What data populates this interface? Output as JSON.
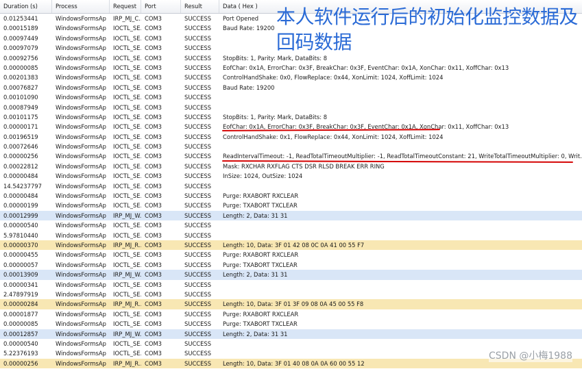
{
  "columns": {
    "duration": "Duration (s)",
    "process": "Process",
    "request": "Request",
    "port": "Port",
    "result": "Result",
    "data": "Data ( Hex )"
  },
  "rows": [
    {
      "duration": "0.01253441",
      "process": "WindowsFormsAp",
      "request": "IRP_MJ_C...",
      "port": "COM3",
      "result": "SUCCESS",
      "data": "Port Opened",
      "highlight": "none"
    },
    {
      "duration": "0.00015189",
      "process": "WindowsFormsAp",
      "request": "IOCTL_SE...",
      "port": "COM3",
      "result": "SUCCESS",
      "data": "Baud Rate: 19200",
      "highlight": "none"
    },
    {
      "duration": "0.00097449",
      "process": "WindowsFormsAp",
      "request": "IOCTL_SE...",
      "port": "COM3",
      "result": "SUCCESS",
      "data": "",
      "highlight": "none"
    },
    {
      "duration": "0.00097079",
      "process": "WindowsFormsAp",
      "request": "IOCTL_SE...",
      "port": "COM3",
      "result": "SUCCESS",
      "data": "",
      "highlight": "none"
    },
    {
      "duration": "0.00092756",
      "process": "WindowsFormsAp",
      "request": "IOCTL_SE...",
      "port": "COM3",
      "result": "SUCCESS",
      "data": "StopBits: 1, Parity: Mark, DataBits: 8",
      "highlight": "none"
    },
    {
      "duration": "0.00000085",
      "process": "WindowsFormsAp",
      "request": "IOCTL_SE...",
      "port": "COM3",
      "result": "SUCCESS",
      "data": "EofChar: 0x1A, ErrorChar: 0x3F, BreakChar: 0x3F, EventChar: 0x1A, XonChar: 0x11, XoffChar: 0x13",
      "highlight": "none"
    },
    {
      "duration": "0.00201383",
      "process": "WindowsFormsAp",
      "request": "IOCTL_SE...",
      "port": "COM3",
      "result": "SUCCESS",
      "data": "ControlHandShake: 0x0, FlowReplace: 0x44, XonLimit: 1024, XoffLimit: 1024",
      "highlight": "none"
    },
    {
      "duration": "0.00076827",
      "process": "WindowsFormsAp",
      "request": "IOCTL_SE...",
      "port": "COM3",
      "result": "SUCCESS",
      "data": "Baud Rate: 19200",
      "highlight": "none"
    },
    {
      "duration": "0.00101090",
      "process": "WindowsFormsAp",
      "request": "IOCTL_SE...",
      "port": "COM3",
      "result": "SUCCESS",
      "data": "",
      "highlight": "none"
    },
    {
      "duration": "0.00087949",
      "process": "WindowsFormsAp",
      "request": "IOCTL_SE...",
      "port": "COM3",
      "result": "SUCCESS",
      "data": "",
      "highlight": "none"
    },
    {
      "duration": "0.00101175",
      "process": "WindowsFormsAp",
      "request": "IOCTL_SE...",
      "port": "COM3",
      "result": "SUCCESS",
      "data": "StopBits: 1, Parity: Mark, DataBits: 8",
      "highlight": "none"
    },
    {
      "duration": "0.00000171",
      "process": "WindowsFormsAp",
      "request": "IOCTL_SE...",
      "port": "COM3",
      "result": "SUCCESS",
      "data": "EofChar: 0x1A, ErrorChar: 0x3F, BreakChar: 0x3F, EventChar: 0x1A, XonChar: 0x11, XoffChar: 0x13",
      "highlight": "none"
    },
    {
      "duration": "0.00196519",
      "process": "WindowsFormsAp",
      "request": "IOCTL_SE...",
      "port": "COM3",
      "result": "SUCCESS",
      "data": "ControlHandShake: 0x1, FlowReplace: 0x44, XonLimit: 1024, XoffLimit: 1024",
      "highlight": "none"
    },
    {
      "duration": "0.00072646",
      "process": "WindowsFormsAp",
      "request": "IOCTL_SE...",
      "port": "COM3",
      "result": "SUCCESS",
      "data": "",
      "highlight": "none"
    },
    {
      "duration": "0.00000256",
      "process": "WindowsFormsAp",
      "request": "IOCTL_SE...",
      "port": "COM3",
      "result": "SUCCESS",
      "data": "ReadIntervalTimeout: -1, ReadTotalTimeoutMultiplier: -1, ReadTotalTimeoutConstant: 21, WriteTotalTimeoutMultiplier: 0, Writ...",
      "highlight": "none"
    },
    {
      "duration": "0.00022812",
      "process": "WindowsFormsAp",
      "request": "IOCTL_SE...",
      "port": "COM3",
      "result": "SUCCESS",
      "data": "Mask: RXCHAR RXFLAG CTS DSR RLSD BREAK ERR RING",
      "highlight": "none"
    },
    {
      "duration": "0.00000484",
      "process": "WindowsFormsAp",
      "request": "IOCTL_SE...",
      "port": "COM3",
      "result": "SUCCESS",
      "data": "InSize: 1024, OutSize: 1024",
      "highlight": "none"
    },
    {
      "duration": "14.54237797",
      "process": "WindowsFormsAp",
      "request": "IOCTL_SE...",
      "port": "COM3",
      "result": "SUCCESS",
      "data": "",
      "highlight": "none"
    },
    {
      "duration": "0.00000484",
      "process": "WindowsFormsAp",
      "request": "IOCTL_SE...",
      "port": "COM3",
      "result": "SUCCESS",
      "data": "Purge: RXABORT RXCLEAR",
      "highlight": "none"
    },
    {
      "duration": "0.00000199",
      "process": "WindowsFormsAp",
      "request": "IOCTL_SE...",
      "port": "COM3",
      "result": "SUCCESS",
      "data": "Purge: TXABORT TXCLEAR",
      "highlight": "none"
    },
    {
      "duration": "0.00012999",
      "process": "WindowsFormsAp",
      "request": "IRP_MJ_W...",
      "port": "COM3",
      "result": "SUCCESS",
      "data": "Length: 2, Data: 31 31",
      "highlight": "blue"
    },
    {
      "duration": "0.00000540",
      "process": "WindowsFormsAp",
      "request": "IOCTL_SE...",
      "port": "COM3",
      "result": "SUCCESS",
      "data": "",
      "highlight": "none"
    },
    {
      "duration": "5.97810440",
      "process": "WindowsFormsAp",
      "request": "IOCTL_SE...",
      "port": "COM3",
      "result": "SUCCESS",
      "data": "",
      "highlight": "none"
    },
    {
      "duration": "0.00000370",
      "process": "WindowsFormsAp",
      "request": "IRP_MJ_R...",
      "port": "COM3",
      "result": "SUCCESS",
      "data": "Length: 10, Data: 3F 01 42 08 0C 0A 41 00 55 F7",
      "highlight": "yellow"
    },
    {
      "duration": "0.00000455",
      "process": "WindowsFormsAp",
      "request": "IOCTL_SE...",
      "port": "COM3",
      "result": "SUCCESS",
      "data": "Purge: RXABORT RXCLEAR",
      "highlight": "none"
    },
    {
      "duration": "0.00000057",
      "process": "WindowsFormsAp",
      "request": "IOCTL_SE...",
      "port": "COM3",
      "result": "SUCCESS",
      "data": "Purge: TXABORT TXCLEAR",
      "highlight": "none"
    },
    {
      "duration": "0.00013909",
      "process": "WindowsFormsAp",
      "request": "IRP_MJ_W...",
      "port": "COM3",
      "result": "SUCCESS",
      "data": "Length: 2, Data: 31 31",
      "highlight": "blue"
    },
    {
      "duration": "0.00000341",
      "process": "WindowsFormsAp",
      "request": "IOCTL_SE...",
      "port": "COM3",
      "result": "SUCCESS",
      "data": "",
      "highlight": "none"
    },
    {
      "duration": "2.47897919",
      "process": "WindowsFormsAp",
      "request": "IOCTL_SE...",
      "port": "COM3",
      "result": "SUCCESS",
      "data": "",
      "highlight": "none"
    },
    {
      "duration": "0.00000284",
      "process": "WindowsFormsAp",
      "request": "IRP_MJ_R...",
      "port": "COM3",
      "result": "SUCCESS",
      "data": "Length: 10, Data: 3F 01 3F 09 08 0A 45 00 55 F8",
      "highlight": "yellow"
    },
    {
      "duration": "0.00001877",
      "process": "WindowsFormsAp",
      "request": "IOCTL_SE...",
      "port": "COM3",
      "result": "SUCCESS",
      "data": "Purge: RXABORT RXCLEAR",
      "highlight": "none"
    },
    {
      "duration": "0.00000085",
      "process": "WindowsFormsAp",
      "request": "IOCTL_SE...",
      "port": "COM3",
      "result": "SUCCESS",
      "data": "Purge: TXABORT TXCLEAR",
      "highlight": "none"
    },
    {
      "duration": "0.00012857",
      "process": "WindowsFormsAp",
      "request": "IRP_MJ_W...",
      "port": "COM3",
      "result": "SUCCESS",
      "data": "Length: 2, Data: 31 31",
      "highlight": "blue"
    },
    {
      "duration": "0.00000540",
      "process": "WindowsFormsAp",
      "request": "IOCTL_SE...",
      "port": "COM3",
      "result": "SUCCESS",
      "data": "",
      "highlight": "none"
    },
    {
      "duration": "5.22376193",
      "process": "WindowsFormsAp",
      "request": "IOCTL_SE...",
      "port": "COM3",
      "result": "SUCCESS",
      "data": "",
      "highlight": "none"
    },
    {
      "duration": "0.00000256",
      "process": "WindowsFormsAp",
      "request": "IRP_MJ_R...",
      "port": "COM3",
      "result": "SUCCESS",
      "data": "Length: 10, Data: 3F 01 40 08 0A 0A 60 00 55 12",
      "highlight": "yellow"
    }
  ],
  "overlay_text": {
    "line1": "本人软件运行后的初始化监控数据及",
    "line2": "回码数据"
  },
  "watermark": "CSDN @小梅1988",
  "colors": {
    "header_bg": "#eef0f4",
    "row_blue": "#d9e6f7",
    "row_yellow": "#f8e7b3",
    "annotation_red": "#d40000",
    "overlay_blue": "#2b6bd6"
  }
}
